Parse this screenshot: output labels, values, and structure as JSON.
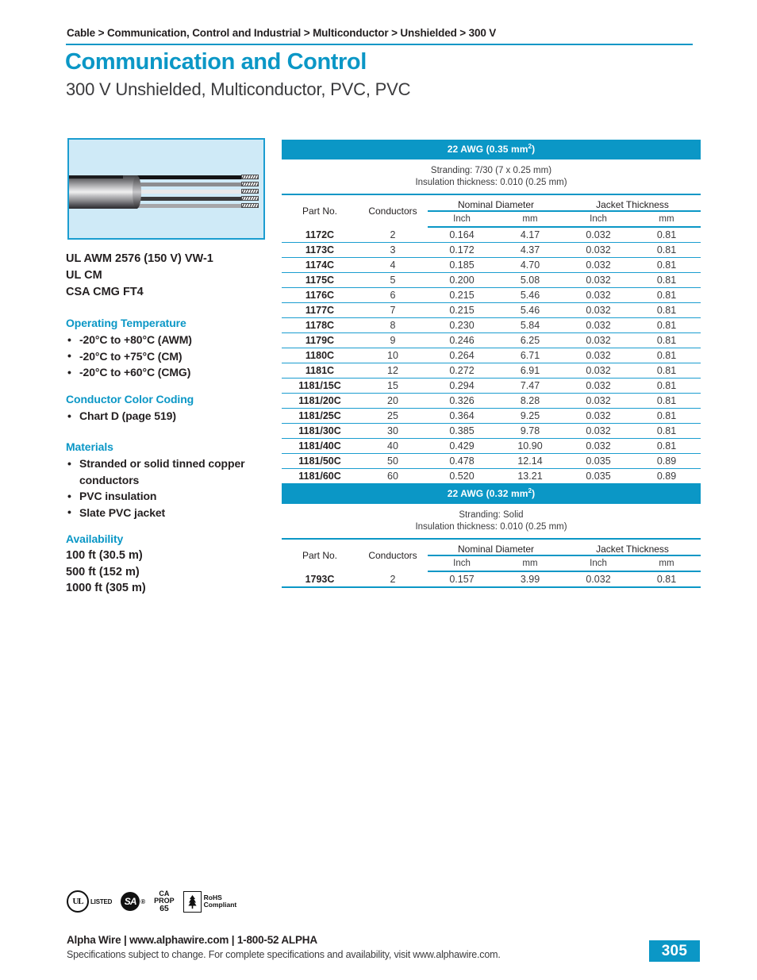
{
  "header": {
    "breadcrumb": "Cable > Communication, Control and Industrial > Multiconductor > Unshielded > 300 V",
    "title": "Communication and Control",
    "subtitle": "300 V Unshielded, Multiconductor, PVC, PVC"
  },
  "product_image": {
    "alt": "multiconductor-cable-photo"
  },
  "sidebar": {
    "approvals": [
      "UL AWM 2576 (150 V) VW-1",
      "UL CM",
      "CSA CMG FT4"
    ],
    "sections": [
      {
        "heading": "Operating Temperature",
        "items": [
          "-20°C to +80°C (AWM)",
          "-20°C to +75°C (CM)",
          "-20°C to +60°C (CMG)"
        ]
      },
      {
        "heading": "Conductor Color Coding",
        "items": [
          "Chart D (page 519)"
        ]
      },
      {
        "heading": "Materials",
        "items": [
          "Stranded or solid tinned copper conductors",
          "PVC insulation",
          "Slate PVC jacket"
        ]
      }
    ],
    "availability": {
      "heading": "Availability",
      "lines": [
        "100 ft (30.5 m)",
        "500 ft (152 m)",
        "1000 ft (305 m)"
      ]
    }
  },
  "tables": [
    {
      "title": "22 AWG (0.35 mm²)",
      "title_base": "22 AWG (0.35 mm",
      "title_sup": "2",
      "title_tail": ")",
      "sub_line1": "Stranding: 7/30 (7 x 0.25 mm)",
      "sub_line2": "Insulation thickness: 0.010 (0.25 mm)",
      "columns": {
        "part": "Part No.",
        "conductors": "Conductors",
        "nominal_diameter": "Nominal Diameter",
        "jacket_thickness": "Jacket Thickness",
        "inch": "Inch",
        "mm": "mm"
      },
      "rows": [
        {
          "part": "1172C",
          "conductors": "2",
          "dia_in": "0.164",
          "dia_mm": "4.17",
          "jkt_in": "0.032",
          "jkt_mm": "0.81"
        },
        {
          "part": "1173C",
          "conductors": "3",
          "dia_in": "0.172",
          "dia_mm": "4.37",
          "jkt_in": "0.032",
          "jkt_mm": "0.81"
        },
        {
          "part": "1174C",
          "conductors": "4",
          "dia_in": "0.185",
          "dia_mm": "4.70",
          "jkt_in": "0.032",
          "jkt_mm": "0.81"
        },
        {
          "part": "1175C",
          "conductors": "5",
          "dia_in": "0.200",
          "dia_mm": "5.08",
          "jkt_in": "0.032",
          "jkt_mm": "0.81"
        },
        {
          "part": "1176C",
          "conductors": "6",
          "dia_in": "0.215",
          "dia_mm": "5.46",
          "jkt_in": "0.032",
          "jkt_mm": "0.81"
        },
        {
          "part": "1177C",
          "conductors": "7",
          "dia_in": "0.215",
          "dia_mm": "5.46",
          "jkt_in": "0.032",
          "jkt_mm": "0.81"
        },
        {
          "part": "1178C",
          "conductors": "8",
          "dia_in": "0.230",
          "dia_mm": "5.84",
          "jkt_in": "0.032",
          "jkt_mm": "0.81"
        },
        {
          "part": "1179C",
          "conductors": "9",
          "dia_in": "0.246",
          "dia_mm": "6.25",
          "jkt_in": "0.032",
          "jkt_mm": "0.81"
        },
        {
          "part": "1180C",
          "conductors": "10",
          "dia_in": "0.264",
          "dia_mm": "6.71",
          "jkt_in": "0.032",
          "jkt_mm": "0.81"
        },
        {
          "part": "1181C",
          "conductors": "12",
          "dia_in": "0.272",
          "dia_mm": "6.91",
          "jkt_in": "0.032",
          "jkt_mm": "0.81"
        },
        {
          "part": "1181/15C",
          "conductors": "15",
          "dia_in": "0.294",
          "dia_mm": "7.47",
          "jkt_in": "0.032",
          "jkt_mm": "0.81"
        },
        {
          "part": "1181/20C",
          "conductors": "20",
          "dia_in": "0.326",
          "dia_mm": "8.28",
          "jkt_in": "0.032",
          "jkt_mm": "0.81"
        },
        {
          "part": "1181/25C",
          "conductors": "25",
          "dia_in": "0.364",
          "dia_mm": "9.25",
          "jkt_in": "0.032",
          "jkt_mm": "0.81"
        },
        {
          "part": "1181/30C",
          "conductors": "30",
          "dia_in": "0.385",
          "dia_mm": "9.78",
          "jkt_in": "0.032",
          "jkt_mm": "0.81"
        },
        {
          "part": "1181/40C",
          "conductors": "40",
          "dia_in": "0.429",
          "dia_mm": "10.90",
          "jkt_in": "0.032",
          "jkt_mm": "0.81"
        },
        {
          "part": "1181/50C",
          "conductors": "50",
          "dia_in": "0.478",
          "dia_mm": "12.14",
          "jkt_in": "0.035",
          "jkt_mm": "0.89"
        },
        {
          "part": "1181/60C",
          "conductors": "60",
          "dia_in": "0.520",
          "dia_mm": "13.21",
          "jkt_in": "0.035",
          "jkt_mm": "0.89"
        }
      ]
    },
    {
      "title": "22 AWG (0.32 mm²)",
      "title_base": "22 AWG (0.32 mm",
      "title_sup": "2",
      "title_tail": ")",
      "sub_line1": "Stranding: Solid",
      "sub_line2": "Insulation thickness: 0.010 (0.25 mm)",
      "columns": {
        "part": "Part No.",
        "conductors": "Conductors",
        "nominal_diameter": "Nominal Diameter",
        "jacket_thickness": "Jacket Thickness",
        "inch": "Inch",
        "mm": "mm"
      },
      "rows": [
        {
          "part": "1793C",
          "conductors": "2",
          "dia_in": "0.157",
          "dia_mm": "3.99",
          "jkt_in": "0.032",
          "jkt_mm": "0.81"
        }
      ]
    }
  ],
  "footer": {
    "certifications": [
      {
        "name": "ul-listed",
        "mark": "UL",
        "label": "LISTED"
      },
      {
        "name": "csa",
        "mark": "SA",
        "label": "®"
      },
      {
        "name": "ca-prop-65",
        "line1": "CA",
        "line2": "PROP",
        "line3": "65"
      },
      {
        "name": "rohs-compliant",
        "line1": "RoHS",
        "line2": "Compliant"
      }
    ],
    "brand_line": "Alpha Wire | www.alphawire.com | 1-800-52 ALPHA",
    "disclaimer": "Specifications subject to change. For complete specifications and availability, visit www.alphawire.com.",
    "page_number": "305"
  },
  "colors": {
    "accent_blue": "#0b97c6",
    "rule_blue": "#1b9dd0",
    "image_bg": "#cfeaf7",
    "text_dark": "#231f20",
    "text_mid": "#3b3b3d"
  }
}
